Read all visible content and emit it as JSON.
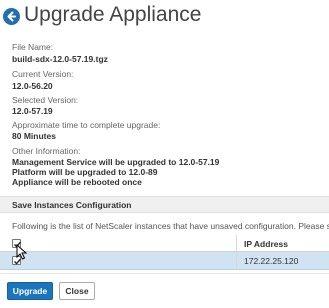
{
  "header": {
    "title": "Upgrade Appliance",
    "back_icon": "back-arrow-icon"
  },
  "details": {
    "file_name_label": "File Name:",
    "file_name_value": "build-sdx-12.0-57.19.tgz",
    "current_version_label": "Current Version:",
    "current_version_value": "12.0-56.20",
    "selected_version_label": "Selected Version:",
    "selected_version_value": "12.0-57.19",
    "time_label": "Approximate time to complete upgrade:",
    "time_value": "80 Minutes",
    "other_label": "Other Information:",
    "other_lines": [
      "Management Service will be upgraded to 12.0-57.19",
      "Platform will be upgraded to 12.0-89",
      "Appliance will be rebooted once"
    ]
  },
  "save_config": {
    "section_title": "Save Instances Configuration",
    "description": "Following is the list of NetScaler instances that have unsaved configuration. Please select the instances",
    "columns": {
      "ip_address": "IP Address"
    },
    "rows": [
      {
        "ip_address": "172.22.25.120",
        "checked": true
      }
    ],
    "select_all_checked": true
  },
  "actions": {
    "upgrade_label": "Upgrade",
    "close_label": "Close"
  },
  "colors": {
    "accent": "#1b75bc",
    "row_selected": "#cfe3f3",
    "section_bg": "#f0f0f0"
  }
}
